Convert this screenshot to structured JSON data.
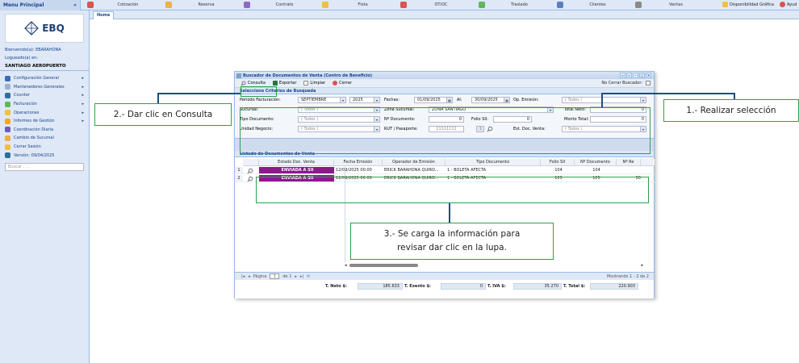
{
  "menu": {
    "title": "Menu Principal",
    "collapse": "«"
  },
  "topnav": [
    {
      "label": "Cotización",
      "color": "#d9534f"
    },
    {
      "label": "Reserva",
      "color": "#f0ad4e"
    },
    {
      "label": "Contrato",
      "color": "#8e6bbf"
    },
    {
      "label": "Flota",
      "color": "#f0c040"
    },
    {
      "label": "OT/OC",
      "color": "#d9534f"
    },
    {
      "label": "Traslado",
      "color": "#5cb85c"
    },
    {
      "label": "Clientes",
      "color": "#5b7fbf"
    },
    {
      "label": "Ventas",
      "color": "#8a8a8a"
    }
  ],
  "topnav_right": {
    "disponibilidad": "Disponibilidad Gráfica",
    "ayuda": "Ayud"
  },
  "tabs": {
    "home": "Home"
  },
  "sidebar": {
    "logo_text": "EBQ",
    "welcome": "Bienvenido(a): EBARAHONA",
    "logged_in": "Logueado(a) en:",
    "branch": "SANTIAGO AEROPUERTO",
    "items": [
      {
        "label": "Configuración General",
        "color": "#3b6cb5",
        "arrow": true
      },
      {
        "label": "Mantenedores Generales",
        "color": "#9bb0cf",
        "arrow": true
      },
      {
        "label": "Counter",
        "color": "#2b6f9a",
        "arrow": true
      },
      {
        "label": "Facturación",
        "color": "#5cb85c",
        "arrow": true
      },
      {
        "label": "Operaciones",
        "color": "#f0c040",
        "arrow": true
      },
      {
        "label": "Informes de Gestión",
        "color": "#f5a623",
        "arrow": true
      },
      {
        "label": "Coordinación Diaria",
        "color": "#6b5bbf",
        "arrow": false
      },
      {
        "label": "Cambio de Sucursal",
        "color": "#f0ad4e",
        "arrow": false
      },
      {
        "label": "Cerrar Sesión",
        "color": "#f0c040",
        "arrow": false
      },
      {
        "label": "Versión: 09/04/2025",
        "color": "#2b6f9a",
        "arrow": false
      }
    ],
    "search_placeholder": "Buscar . . ."
  },
  "dialog": {
    "title": "Buscador de Documentos de Venta (Centro de Beneficio)",
    "toolbar": {
      "consulta": "Consulta",
      "exportar": "Exportar",
      "limpiar": "Limpiar",
      "cerrar": "Cerrar",
      "no_cerrar": "No Cerrar Buscador:"
    },
    "criteria_title": "Seleccione Criterios de Busqueda",
    "criteria": {
      "periodo_label": "Periodo Facturación:",
      "periodo_mes": "SEPTIEMBRE",
      "periodo_anio": "2025",
      "fechas_label": "Fechas:",
      "fecha_desde": "01/09/2025",
      "al_label": "Al:",
      "fecha_hasta": "30/09/2025",
      "op_emision_label": "Op. Emisión:",
      "op_emision": "( Todos )",
      "sucursal_label": "Sucursal:",
      "sucursal": "( Todos )",
      "zona_label": "Zona Sucursal:",
      "zona": "ZONA SANTIAGO",
      "total_neto_label": "Total Neto:",
      "total_neto": "0",
      "tipo_doc_label": "Tipo Documento:",
      "tipo_doc": "( Todos )",
      "num_doc_label": "Nº Documento:",
      "num_doc": "0",
      "folio_sii_label": "Folio SII:",
      "folio_sii": "0",
      "monto_total_label": "Monto Total:",
      "monto_total": "0",
      "unidad_label": "Unidad Negocio:",
      "unidad": "( Todos )",
      "rut_label": "RUT / Pasaporte:",
      "rut": "11111111",
      "rut_dv": "1",
      "est_doc_label": "Est. Doc. Venta:",
      "est_doc": "( Todos )"
    },
    "list_title": "Listado de Documentos de Venta",
    "columns": [
      "Estado Doc. Venta",
      "Fecha Emisión",
      "Operador de Emisión",
      "Tipo Documento",
      "Folio SII",
      "Nº Documento",
      "Nº Re"
    ],
    "rows": [
      {
        "num": "1",
        "estado": "ENVIADA A SII",
        "fecha": "12/09/2025 00:00",
        "operador": "ERICK BARAHONA QUIRO...",
        "tipo": "1 - BOLETA AFECTA",
        "folio": "104",
        "ndoc": "104",
        "nre": ""
      },
      {
        "num": "2",
        "estado": "ENVIADA A SII",
        "fecha": "12/09/2025 00:00",
        "operador": "ERICK BARAHONA QUIRO...",
        "tipo": "1 - BOLETA AFECTA",
        "folio": "105",
        "ndoc": "105",
        "nre": "50"
      }
    ],
    "paging": {
      "pagina_label": "Página",
      "page": "1",
      "de": "de 1",
      "mostrando": "Mostrando 1 - 2 de 2"
    },
    "totals": {
      "neto_label": "T. Neto $:",
      "neto": "185.633",
      "exento_label": "T. Exento $:",
      "exento": "0",
      "iva_label": "T. IVA $:",
      "iva": "35.270",
      "total_label": "T. Total $:",
      "total": "220.903"
    }
  },
  "annotations": {
    "step1": "1.- Realizar selección",
    "step2": "2.- Dar clic en Consulta",
    "step3_line1": "3.- Se carga la información para",
    "step3_line2": "revisar  dar clic en la lupa."
  },
  "colors": {
    "highlight": "#2aa24a",
    "connector": "#1f4e79",
    "estado_bg": "#8b1a8c"
  }
}
